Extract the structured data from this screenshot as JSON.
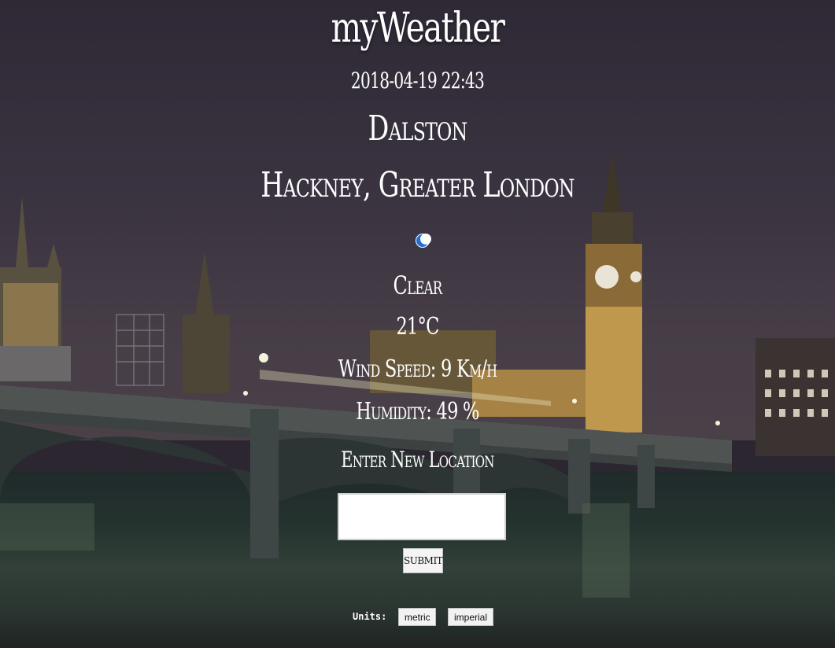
{
  "app": {
    "title": "myWeather"
  },
  "weather": {
    "datetime": "2018-04-19 22:43",
    "city": "Dalston",
    "region": "Hackney, Greater London",
    "icon": "crescent-moon-icon",
    "condition": "Clear",
    "temperature": "21°C",
    "wind": "Wind Speed: 9 Km/h",
    "humidity": "Humidity: 49 %"
  },
  "form": {
    "prompt": "Enter New Location",
    "location_value": "",
    "submit_label": "SUBMIT"
  },
  "units": {
    "label": "Units:",
    "metric_label": "metric",
    "imperial_label": "imperial"
  },
  "colors": {
    "text": "#ffffff",
    "moon_icon": "#1e6fd6"
  }
}
